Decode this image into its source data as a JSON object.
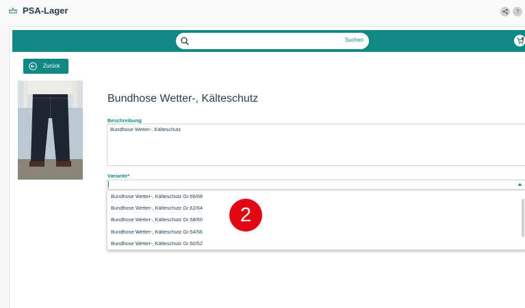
{
  "app": {
    "title": "PSA-Lager"
  },
  "search": {
    "placeholder": "",
    "button_label": "Suchen"
  },
  "back_button": {
    "label": "Zurück"
  },
  "product": {
    "title": "Bundhose Wetter-, Kälteschutz",
    "description_label": "Beschreibung",
    "description": "Bundhose Wetter-, Kälteschutz",
    "variant_label": "Variante",
    "required_mark": "*"
  },
  "variants": {
    "options": [
      "Bundhose Wetter-, Kälteschutz Gr.66/68",
      "Bundhose Wetter-, Kälteschutz Gr.62/64",
      "Bundhose Wetter-, Kälteschutz Gr.58/60",
      "Bundhose Wetter-, Kälteschutz Gr.54/56",
      "Bundhose Wetter-, Kälteschutz Gr.50/52"
    ]
  },
  "step_badge": {
    "number": "2"
  },
  "colors": {
    "primary": "#108984",
    "badge": "#e10613",
    "title": "#1f3b4d"
  },
  "icons": {
    "app": "crown-icon",
    "share": "share-icon",
    "help": "help-icon",
    "search": "search-icon",
    "cart": "cart-icon",
    "back": "arrow-left-circle-icon"
  }
}
